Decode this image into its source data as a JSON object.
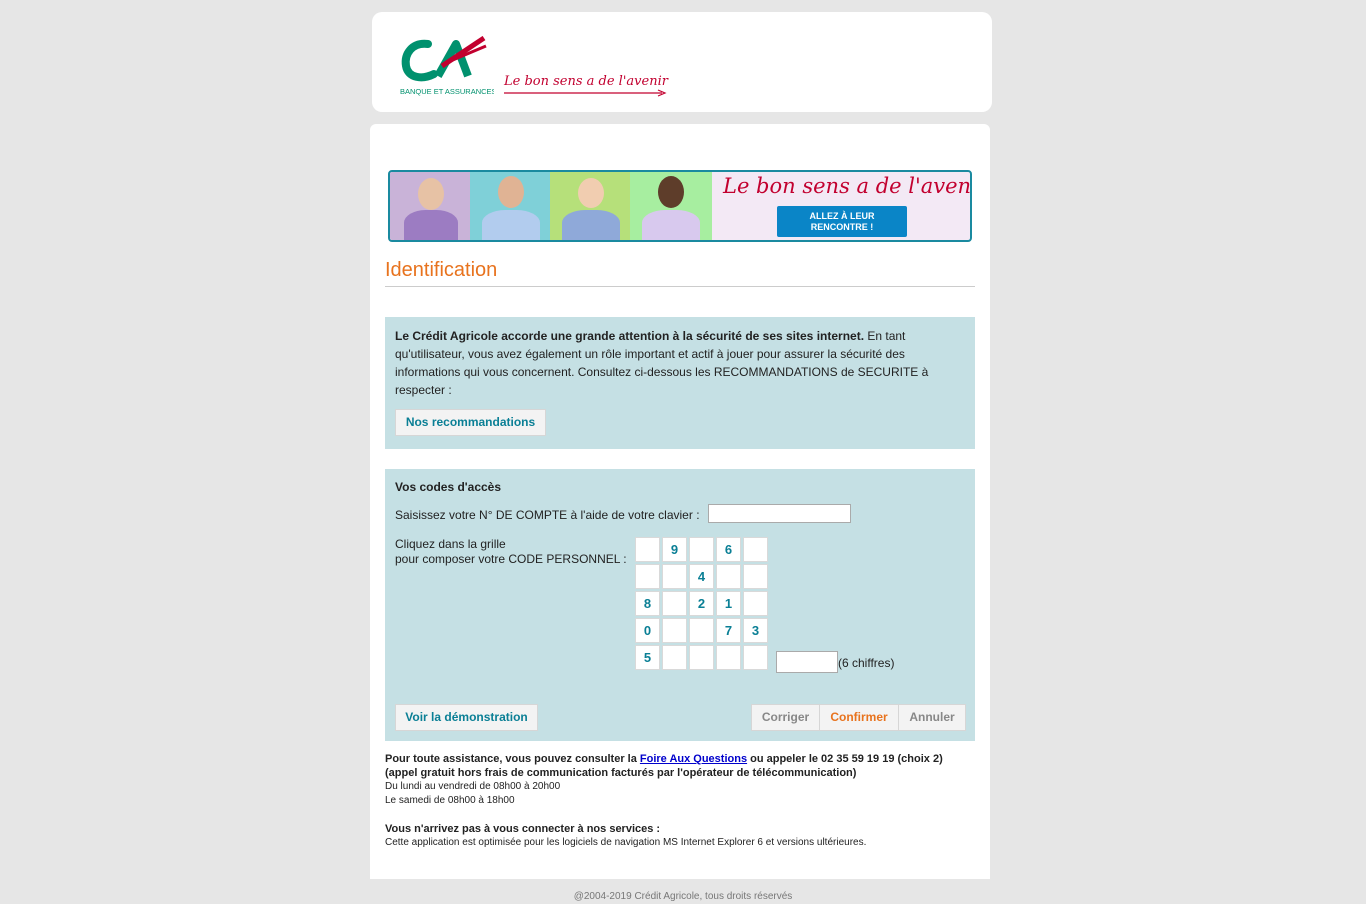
{
  "header": {
    "logo_text": "CA",
    "logo_subtitle": "BANQUE ET ASSURANCES",
    "slogan": "Le bon sens a de l'avenir"
  },
  "banner": {
    "slogan": "Le bon sens a de l'avenir",
    "button_line1": "ALLEZ À LEUR",
    "button_line2": "RENCONTRE !"
  },
  "identification": {
    "title": "Identification"
  },
  "security": {
    "bold_text": "Le Crédit Agricole accorde une grande attention à la sécurité de ses sites internet.",
    "text": " En tant qu'utilisateur, vous avez également un rôle important et actif à jouer pour assurer la sécurité des informations qui vous concernent. Consultez ci-dessous les RECOMMANDATIONS de SECURITE à respecter :",
    "button": "Nos recommandations"
  },
  "codes": {
    "title": "Vos codes d'accès",
    "account_label": "Saisissez votre N° DE COMPTE à l'aide de votre clavier :",
    "account_value": "",
    "grid_label_line1": "Cliquez dans la grille",
    "grid_label_line2": "pour composer votre CODE PERSONNEL :",
    "keypad": [
      [
        "",
        "9",
        "",
        "6",
        ""
      ],
      [
        "",
        "",
        "4",
        "",
        ""
      ],
      [
        "8",
        "",
        "2",
        "1",
        ""
      ],
      [
        "0",
        "",
        "",
        "7",
        "3"
      ],
      [
        "5",
        "",
        "",
        "",
        ""
      ]
    ],
    "pin_value": "",
    "pin_hint": "(6 chiffres)",
    "demo_button": "Voir la démonstration",
    "correct_button": "Corriger",
    "confirm_button": "Confirmer",
    "cancel_button": "Annuler"
  },
  "assistance": {
    "line1_pre": "Pour toute assistance, vous pouvez consulter la ",
    "faq_link": "Foire Aux Questions",
    "line1_post": " ou appeler le 02 35 59 19 19 (choix 2)",
    "line2": "(appel gratuit hors frais de communication facturés par l'opérateur de télécommunication)",
    "hours1": "Du lundi au vendredi de 08h00 à 20h00",
    "hours2": "Le samedi de 08h00 à 18h00",
    "connect_title": "Vous n'arrivez pas à vous connecter à nos services :",
    "connect_text": "Cette application est optimisée pour les logiciels de navigation MS Internet Explorer 6 et versions ultérieures."
  },
  "footer": {
    "copyright": "@2004-2019 Crédit Agricole, tous droits réservés"
  },
  "colors": {
    "accent_orange": "#e8731e",
    "teal": "#0a7f95",
    "panel_bg": "#c5e0e4",
    "brand_red": "#c2002f",
    "brand_green": "#00916e"
  }
}
